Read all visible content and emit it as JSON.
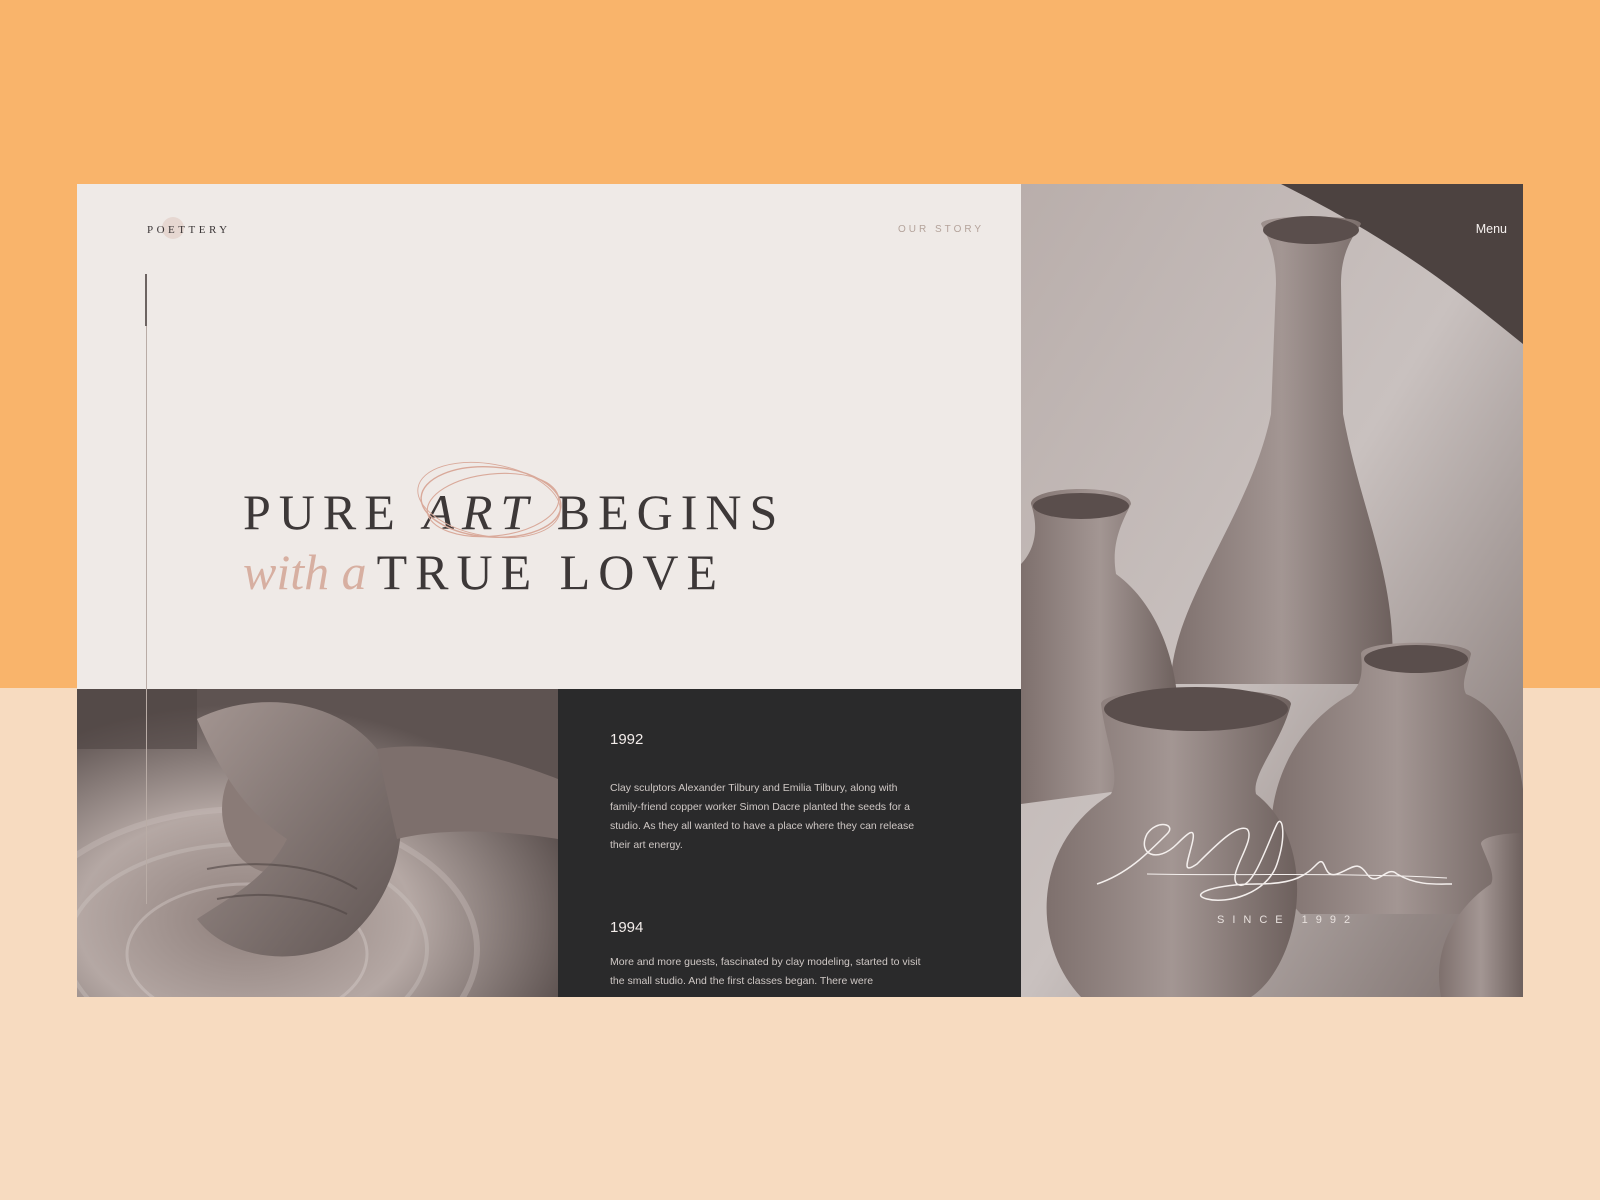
{
  "header": {
    "logo": "POETTERY",
    "nav_link": "OUR STORY",
    "menu": "Menu"
  },
  "hero": {
    "line1_pre": "PURE",
    "line1_art": "ART",
    "line1_post": "BEGINS",
    "line2_script": "with a",
    "line2_main": "TRUE LOVE"
  },
  "timeline": [
    {
      "year": "1992",
      "text": "Clay sculptors Alexander Tilbury and Emilia Tilbury, along with family-friend copper worker Simon Dacre planted the seeds for a studio. As they all wanted to have a place where they can release their art energy."
    },
    {
      "year": "1994",
      "text": "More and more guests, fascinated by clay modeling, started to visit the small studio. And the first classes began. There were"
    }
  ],
  "photo": {
    "since": "SINCE 1992"
  },
  "colors": {
    "bg_top": "#f9b46b",
    "bg_bottom": "#f7dbc0",
    "panel_light": "#efeae7",
    "panel_dark": "#2a2a2b",
    "accent_rose": "#d7afa1"
  }
}
